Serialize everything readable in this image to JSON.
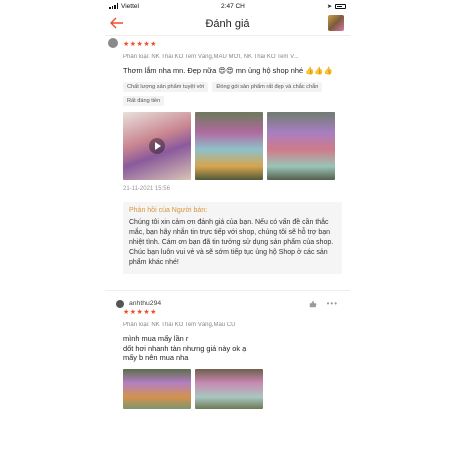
{
  "status": {
    "carrier": "Viettel",
    "time": "2:47 CH"
  },
  "header": {
    "title": "Đánh giá"
  },
  "review1": {
    "stars": "★★★★★",
    "variant": "Phân loại: NK Thái KO Tem Vàng,MẪU MỚI, NK Thái KO Tem V...",
    "comment": "Thơm lắm nha mn. Đẹp nữa 😍😍 mn ủng hộ shop nhé 👍👍👍",
    "tags": [
      "Chất lượng sản phẩm tuyệt vời",
      "Đóng gói sản phẩm rất đẹp và chắc chắn",
      "Rất đáng tiền"
    ],
    "date": "21-11-2021 15:56",
    "reply_title": "Phản hồi của Người bán:",
    "reply_body": "Chúng tôi  xin cảm ơn đánh giá của bạn. Nếu có vấn đề cần thắc mắc, bạn hãy nhắn tin trực tiếp với shop, chúng tôi sẽ hỗ trợ bạn nhiệt tình. Cám ơn bạn đã tin tưởng sử dụng sản phẩm của shop. Chúc bạn luôn vui vẻ và sẽ sớm tiếp tục ủng hộ Shop ở các sản phẩm khác nhé!"
  },
  "review2": {
    "username": "anhthu294",
    "stars": "★★★★★",
    "variant": "Phân loại: NK Thái KO Tem Vàng,Mẫu CŨ",
    "comment_lines": [
      "mình mua mấy lần r",
      "dốt hơi nhanh tàn nhưng giá này ok ạ",
      "mấy b nên mua nha"
    ]
  },
  "colors": {
    "accent": "#ee4d2d",
    "reply_title": "#d8953c"
  },
  "icons": {
    "back": "back-arrow-icon",
    "like": "thumbs-up-icon",
    "more": "more-icon",
    "play": "play-icon"
  }
}
